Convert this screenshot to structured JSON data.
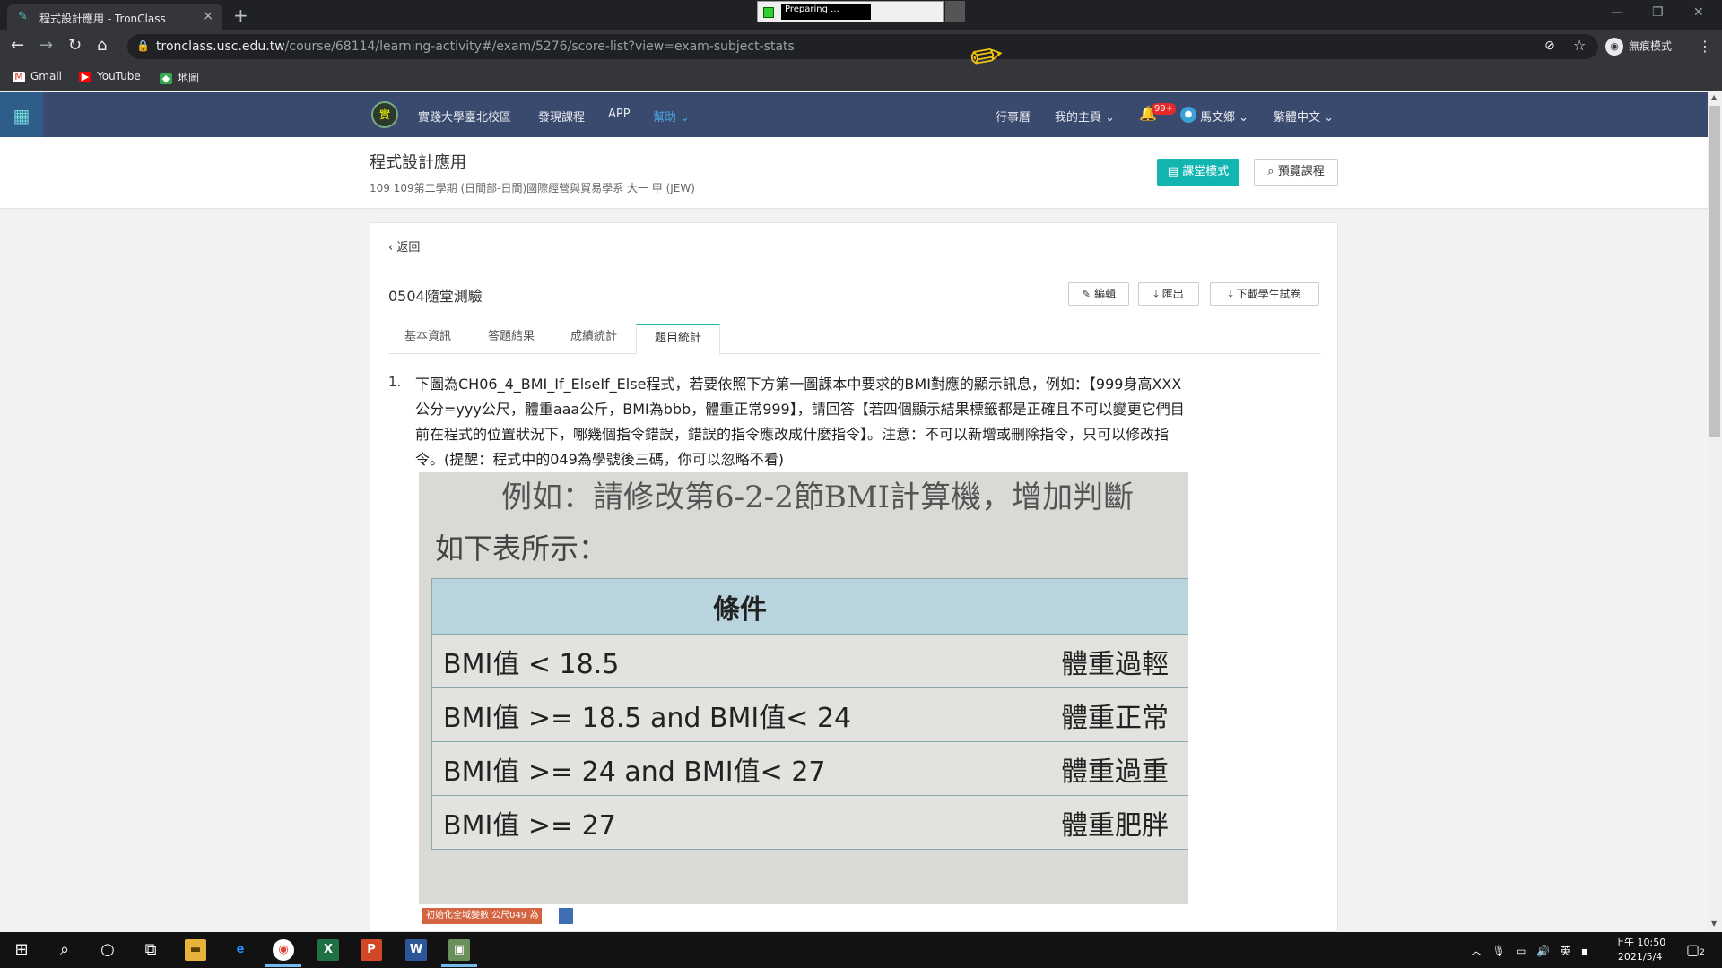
{
  "browser": {
    "tab_title": "程式設計應用 - TronClass",
    "tab_close": "×",
    "new_tab": "+",
    "recorder_text": "Preparing ...",
    "url_host": "tronclass.usc.edu.tw",
    "url_path": "/course/68114/learning-activity#/exam/5276/score-list?view=exam-subject-stats",
    "incognito_label": "無痕模式",
    "bookmarks": [
      {
        "label": "Gmail",
        "icon": "gmail-icon"
      },
      {
        "label": "YouTube",
        "icon": "youtube-icon"
      },
      {
        "label": "地圖",
        "icon": "maps-icon"
      }
    ]
  },
  "site_nav": {
    "logo_text": "實",
    "campus": "實踐大學臺北校區",
    "discover": "發現課程",
    "app": "APP",
    "help": "幫助",
    "calendar": "行事曆",
    "my_home": "我的主頁",
    "notification_count": "99+",
    "user": "馬文鄉",
    "language": "繁體中文"
  },
  "course": {
    "title": "程式設計應用",
    "subtitle": "109 109第二學期 (日間部-日間)國際經營與貿易學系 大一 甲 (JEW)",
    "classroom_mode": "課堂模式",
    "preview": "預覽課程"
  },
  "exam": {
    "back": "返回",
    "title": "0504隨堂測驗",
    "edit": "編輯",
    "export": "匯出",
    "download": "下載學生試卷",
    "tabs": [
      "基本資訊",
      "答題結果",
      "成績統計",
      "題目統計"
    ],
    "active_tab": "題目統計",
    "question_number": "1.",
    "question_text": "下圖為CH06_4_BMI_If_ElseIf_Else程式，若要依照下方第一圖課本中要求的BMI對應的顯示訊息，例如：【999身高XXX公分=yyy公尺，體重aaa公斤，BMI為bbb，體重正常999】，請回答【若四個顯示結果標籤都是正確且不可以變更它們目前在程式的位置狀況下，哪幾個指令錯誤，錯誤的指令應改成什麼指令】。注意：不可以新增或刪除指令，只可以修改指令。(提醒：程式中的049為學號後三碼，你可以忽略不看)"
  },
  "photo": {
    "line1": "例如：請修改第6-2-2節BMI計算機，增加判斷",
    "line2": "如下表所示：",
    "header": "條件",
    "rows": [
      {
        "cond": "BMI值 < 18.5",
        "result": "體重過輕"
      },
      {
        "cond": "BMI值 >= 18.5 and BMI值< 24",
        "result": "體重正常"
      },
      {
        "cond": "BMI值 >= 24 and BMI值< 27",
        "result": "體重過重"
      },
      {
        "cond": "BMI值 >= 27",
        "result": "體重肥胖"
      }
    ],
    "caption": "初始化全域變數 公尺049 為"
  },
  "taskbar": {
    "tray_lang": "英",
    "time": "上午 10:50",
    "date": "2021/5/4",
    "notif_count": "2"
  }
}
